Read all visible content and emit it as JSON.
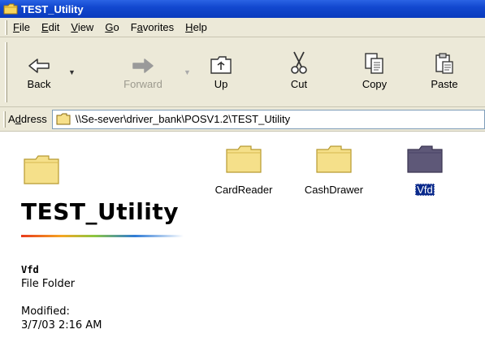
{
  "window": {
    "title": "TEST_Utility"
  },
  "menu": [
    {
      "id": "file",
      "pre": "",
      "ul": "F",
      "post": "ile"
    },
    {
      "id": "edit",
      "pre": "",
      "ul": "E",
      "post": "dit"
    },
    {
      "id": "view",
      "pre": "",
      "ul": "V",
      "post": "iew"
    },
    {
      "id": "go",
      "pre": "",
      "ul": "G",
      "post": "o"
    },
    {
      "id": "favorites",
      "pre": "F",
      "ul": "a",
      "post": "vorites"
    },
    {
      "id": "help",
      "pre": "",
      "ul": "H",
      "post": "elp"
    }
  ],
  "toolbar": {
    "back_label": "Back",
    "forward_label": "Forward",
    "up_label": "Up",
    "cut_label": "Cut",
    "copy_label": "Copy",
    "paste_label": "Paste"
  },
  "address": {
    "label_pre": "A",
    "label_ul": "d",
    "label_post": "dress",
    "value": "\\\\Se-sever\\driver_bank\\POSV1.2\\TEST_Utility"
  },
  "webview": {
    "folder_title": "TEST_Utility",
    "selected_name": "Vfd",
    "selected_type": "File Folder",
    "modified_label": "Modified:",
    "modified_value": "3/7/03 2:16 AM"
  },
  "folders": [
    {
      "name": "CardReader",
      "selected": false
    },
    {
      "name": "CashDrawer",
      "selected": false
    },
    {
      "name": "Vfd",
      "selected": true
    }
  ],
  "colors": {
    "titlebar": "#0a3bbd",
    "chrome": "#ece9d8",
    "folder_yellow": "#f5e08a",
    "folder_selected": "#5e5878",
    "selection": "#0a2a8c"
  }
}
